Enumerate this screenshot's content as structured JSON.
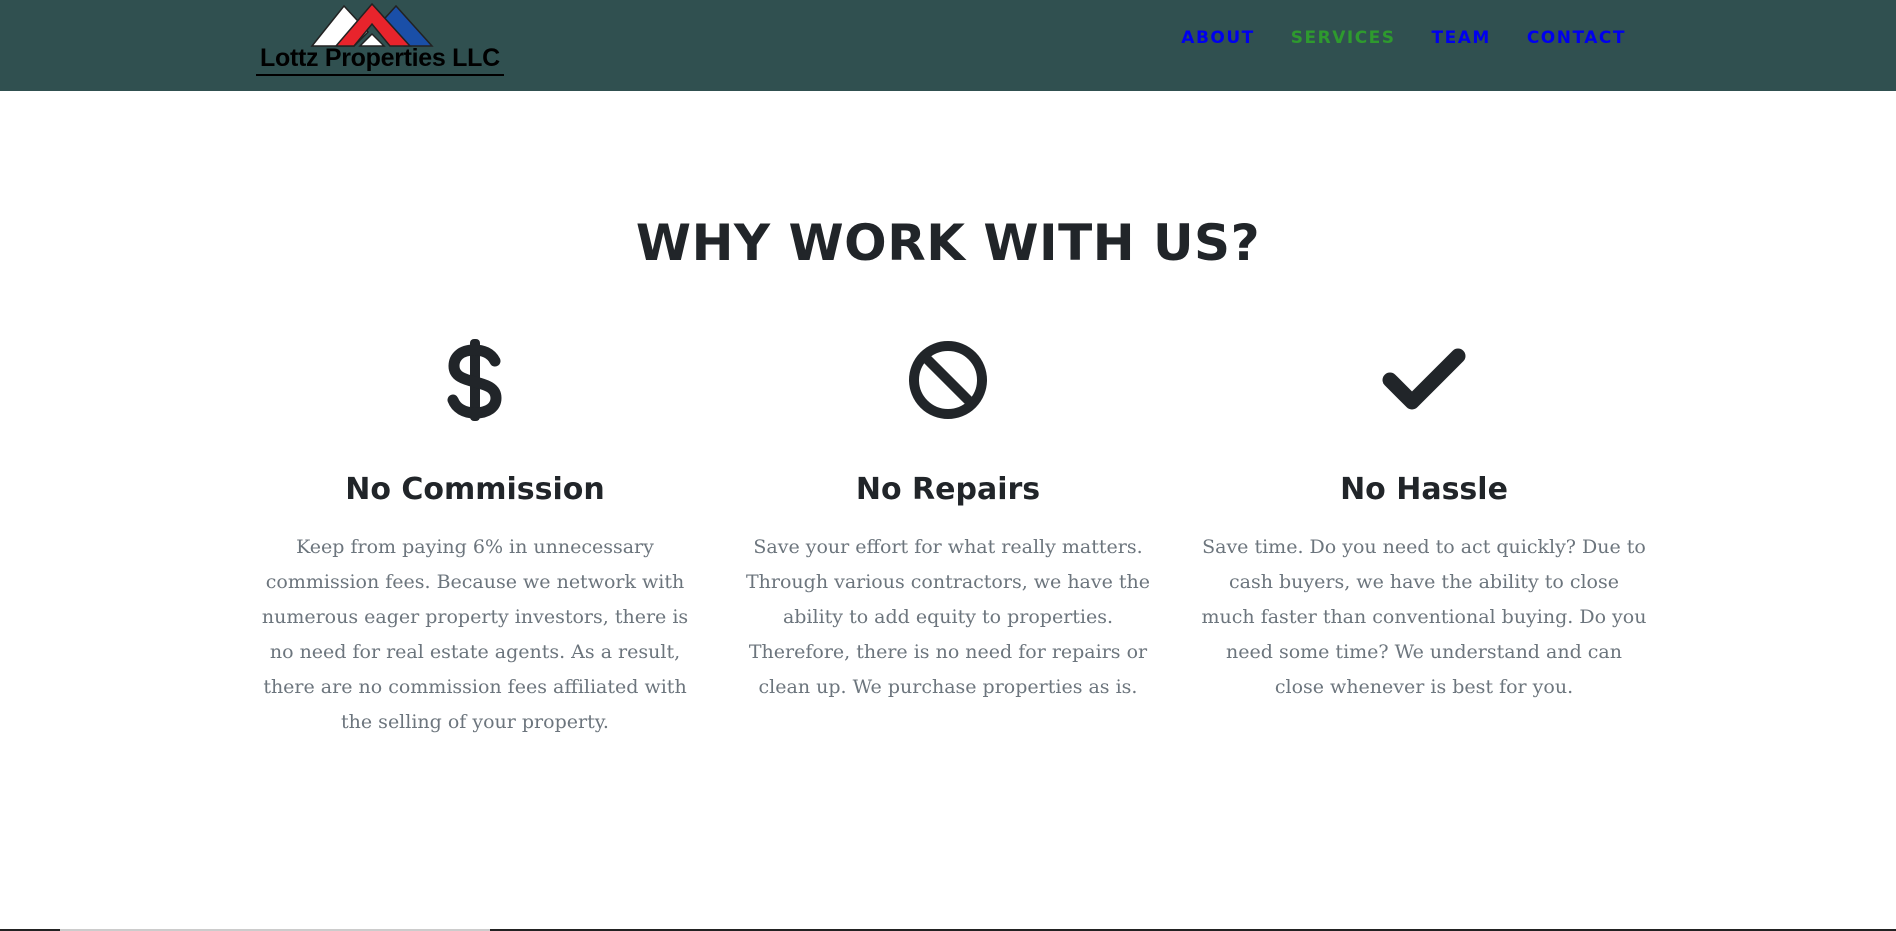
{
  "brand": {
    "name": "Lottz Properties LLC",
    "colors": [
      "#ffffff",
      "#e8242c",
      "#1a4fa8"
    ]
  },
  "nav": {
    "items": [
      {
        "label": "ABOUT",
        "color": "#0000ee"
      },
      {
        "label": "SERVICES",
        "color": "#2e9a2e",
        "active": true
      },
      {
        "label": "TEAM",
        "color": "#0000ee"
      },
      {
        "label": "CONTACT",
        "color": "#0000ee"
      }
    ]
  },
  "section": {
    "title": "WHY WORK WITH US?",
    "features": [
      {
        "icon": "dollar-icon",
        "title": "No Commission",
        "text": "Keep from paying 6% in unnecessary commission fees. Because we network with numerous eager property investors, there is no need for real estate agents. As a result, there are no commission fees affiliated with the selling of your property."
      },
      {
        "icon": "ban-icon",
        "title": "No Repairs",
        "text": "Save your effort for what really matters. Through various contractors, we have the ability to add equity to properties. Therefore, there is no need for repairs or clean up. We purchase properties as is."
      },
      {
        "icon": "check-icon",
        "title": "No Hassle",
        "text": "Save time. Do you need to act quickly? Due to cash buyers, we have the ability to close much faster than conventional buying. Do you need some time? We understand and can close whenever is best for you."
      }
    ]
  },
  "colors": {
    "navbar_bg": "#305050",
    "heading": "#212529",
    "body_text": "#6c757d"
  }
}
